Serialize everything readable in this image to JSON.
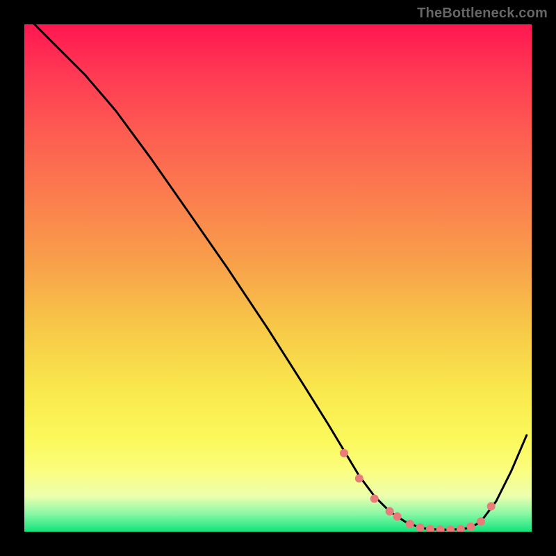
{
  "watermark": "TheBottleneck.com",
  "chart_data": {
    "type": "line",
    "title": "",
    "xlabel": "",
    "ylabel": "",
    "xlim": [
      0,
      100
    ],
    "ylim": [
      0,
      100
    ],
    "grid": false,
    "series": [
      {
        "name": "bottleneck-curve",
        "color": "#000000",
        "x": [
          2,
          5,
          8,
          12,
          18,
          25,
          32,
          40,
          48,
          55,
          60,
          63,
          66,
          69,
          72,
          75,
          78,
          80,
          82,
          84,
          86,
          88,
          90,
          93,
          96,
          99
        ],
        "y": [
          100,
          97,
          94,
          90,
          83,
          73.5,
          63.5,
          52,
          40,
          29,
          21,
          16,
          11,
          7,
          4,
          2,
          0.8,
          0.5,
          0.4,
          0.4,
          0.5,
          0.8,
          2,
          6,
          12,
          19
        ]
      }
    ],
    "markers": {
      "name": "highlight-dots",
      "color": "#e97b7b",
      "radius": 6,
      "x": [
        63,
        66,
        69,
        72,
        73.5,
        76,
        78,
        80,
        82,
        84,
        86,
        88,
        90,
        92
      ],
      "y": [
        15.5,
        10.5,
        6.5,
        4,
        3,
        1.5,
        0.8,
        0.5,
        0.4,
        0.4,
        0.5,
        1,
        2,
        5
      ]
    },
    "background_gradient": {
      "top": "#ff1750",
      "mid": "#f7c948",
      "bottom": "#11e37a"
    }
  }
}
